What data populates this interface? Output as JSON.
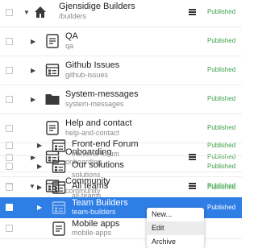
{
  "status_label": "Published",
  "rows": [
    {
      "title": "Gjensidige Builders",
      "slug": "/builders"
    },
    {
      "title": "QA",
      "slug": "qa"
    },
    {
      "title": "Github Issues",
      "slug": "github-issues"
    },
    {
      "title": "System-messages",
      "slug": "system-messages"
    },
    {
      "title": "Help and contact",
      "slug": "help-and-contact"
    },
    {
      "title": "Onboarding",
      "slug": "onboarding"
    },
    {
      "title": "Community",
      "slug": "community"
    },
    {
      "title": "Front-end Forum",
      "slug": "frontend-forum"
    },
    {
      "title": "Our solutions",
      "slug": "solutions"
    },
    {
      "title": "All teams",
      "slug": "all-teams"
    },
    {
      "title": "Team Builders",
      "slug": "team-builders"
    },
    {
      "title": "Mobile apps",
      "slug": "mobile-apps"
    }
  ],
  "context_menu": {
    "items": [
      "New...",
      "Edit",
      "Archive"
    ]
  },
  "colors": {
    "selected_row": "#2f7ee6",
    "status_green": "#3ca248"
  }
}
